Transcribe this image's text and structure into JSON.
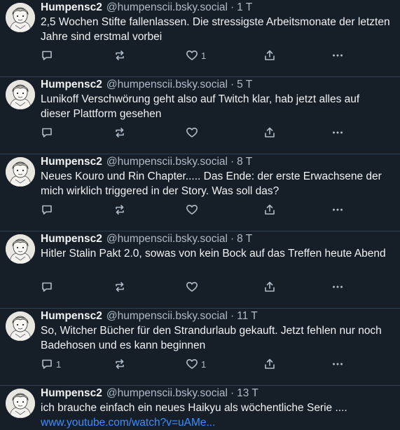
{
  "posts": [
    {
      "name": "Humpensc2",
      "handle": "@humpenscii.bsky.social",
      "sep": "·",
      "time": "1 T",
      "lines": [
        "2,5 Wochen Stifte fallenlassen. Die stressigste Arbeitsmonate der letzten",
        "Jahre sind erstmal vorbei"
      ],
      "reply_count": "",
      "repost_count": "",
      "like_count": "1"
    },
    {
      "name": "Humpensc2",
      "handle": "@humpenscii.bsky.social",
      "sep": "·",
      "time": "5 T",
      "lines": [
        "Lunikoff Verschwörung geht also auf Twitch klar, hab jetzt alles auf",
        "dieser Plattform gesehen"
      ],
      "reply_count": "",
      "repost_count": "",
      "like_count": ""
    },
    {
      "name": "Humpensc2",
      "handle": "@humpenscii.bsky.social",
      "sep": "·",
      "time": "8 T",
      "lines": [
        "Neues Kouro und Rin Chapter..... Das Ende: der erste Erwachsene der",
        "mich wirklich triggered in der Story. Was soll das?"
      ],
      "reply_count": "",
      "repost_count": "",
      "like_count": ""
    },
    {
      "name": "Humpensc2",
      "handle": "@humpenscii.bsky.social",
      "sep": "·",
      "time": "8 T",
      "lines": [
        "Hitler Stalin Pakt 2.0, sowas von kein Bock auf das Treffen heute Abend",
        ""
      ],
      "reply_count": "",
      "repost_count": "",
      "like_count": ""
    },
    {
      "name": "Humpensc2",
      "handle": "@humpenscii.bsky.social",
      "sep": "·",
      "time": "11 T",
      "lines": [
        "So, Witcher Bücher für den Strandurlaub gekauft. Jetzt fehlen nur noch",
        "Badehosen und es kann beginnen"
      ],
      "reply_count": "1",
      "repost_count": "",
      "like_count": "1"
    },
    {
      "name": "Humpensc2",
      "handle": "@humpenscii.bsky.social",
      "sep": "·",
      "time": "13 T",
      "lines": [
        "ich brauche einfach ein neues Haikyu als wöchentliche Serie ...."
      ],
      "link": "www.youtube.com/watch?v=uAMe...",
      "reply_count": "",
      "repost_count": "",
      "like_count": ""
    }
  ],
  "colors": {
    "background": "#161e27",
    "text": "#f1f3f5",
    "muted": "#aebbc9",
    "link": "#3d8eff",
    "divider": "#2e4052"
  },
  "icons": [
    "reply-icon",
    "repost-icon",
    "like-icon",
    "share-icon",
    "more-icon"
  ]
}
